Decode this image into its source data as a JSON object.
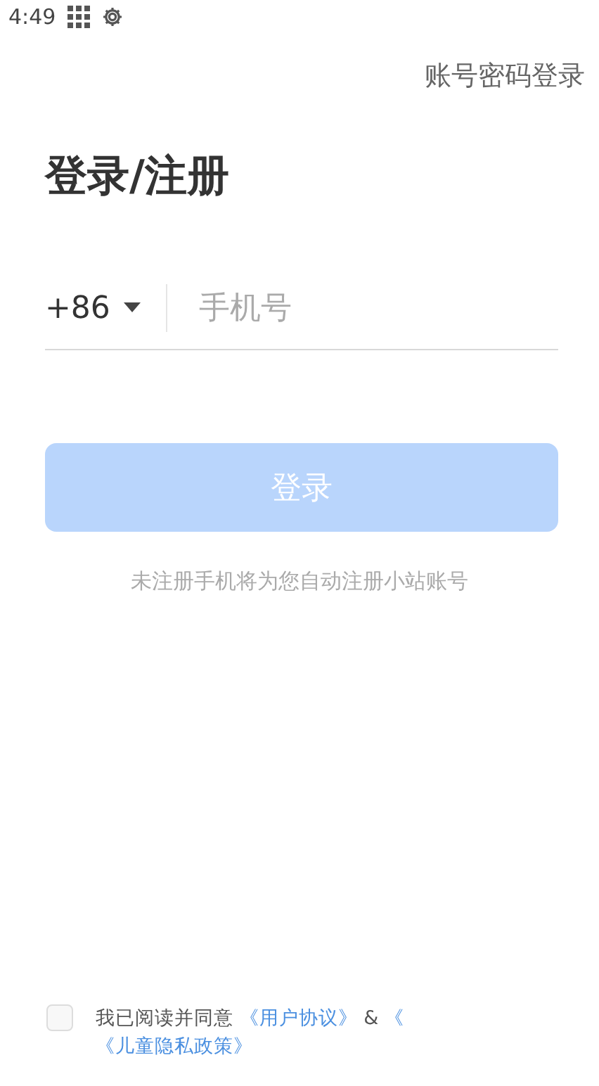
{
  "status_bar": {
    "time": "4:49"
  },
  "top_link": "账号密码登录",
  "title": "登录/注册",
  "phone": {
    "country_code": "+86",
    "placeholder": "手机号"
  },
  "login_button": {
    "label": "登录",
    "disabled": true
  },
  "hint": "未注册手机将为您自动注册小站账号",
  "agreement": {
    "checked": false,
    "text": "我已阅读并同意",
    "links": [
      "《用户协议》",
      "《"
    ],
    "separator": "&",
    "second_line_link": "《儿童隐私政策》"
  }
}
